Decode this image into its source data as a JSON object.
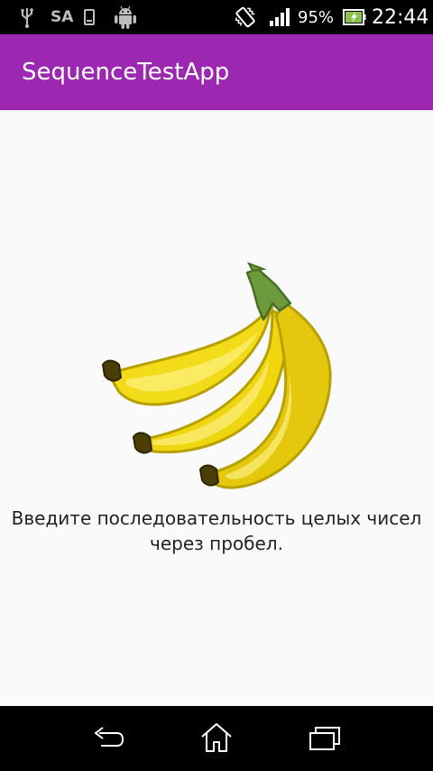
{
  "status_bar": {
    "carrier_label": "SA",
    "battery_percent": "95%",
    "time": "22:44",
    "icons": [
      "usb-icon",
      "sim-icon",
      "android-debug-icon",
      "vibrate-icon",
      "signal-icon",
      "battery-charging-icon"
    ]
  },
  "app_bar": {
    "title": "SequenceTestApp",
    "color": "#9c27b0"
  },
  "content": {
    "illustration": "banana-icon",
    "instruction": "Введите последовательность целых чисел через пробел."
  },
  "nav_bar": {
    "buttons": [
      "back-button",
      "home-button",
      "recents-button"
    ]
  }
}
